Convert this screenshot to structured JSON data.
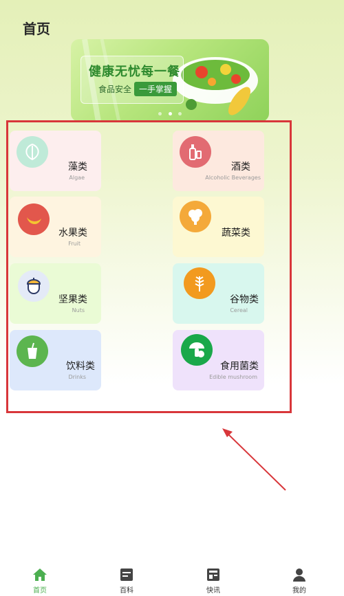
{
  "header": {
    "title": "首页"
  },
  "banner": {
    "headline": "健康无忧每一餐",
    "sub_text": "食品安全",
    "pill_text": "一手掌握",
    "slides": 3,
    "active_slide": 1
  },
  "categories": [
    {
      "name": "藻类",
      "en": "Algae",
      "bg": "#fdeeee",
      "icon_bg": "#bfead8"
    },
    {
      "name": "酒类",
      "en": "Alcoholic Beverages",
      "bg": "#fde9df",
      "icon_bg": "#e26b72"
    },
    {
      "name": "水果类",
      "en": "Fruit",
      "bg": "#fef4e0",
      "icon_bg": "#e2574c"
    },
    {
      "name": "蔬菜类",
      "en": "",
      "bg": "#fdf8d2",
      "icon_bg": "#f4a93a"
    },
    {
      "name": "坚果类",
      "en": "Nuts",
      "bg": "#eafbd5",
      "icon_bg": "#e4eaf7"
    },
    {
      "name": "谷物类",
      "en": "Cereal",
      "bg": "#d8f7ee",
      "icon_bg": "#f29a1f"
    },
    {
      "name": "饮料类",
      "en": "Drinks",
      "bg": "#dde8fb",
      "icon_bg": "#5cb54f"
    },
    {
      "name": "食用菌类",
      "en": "Edible mushroom",
      "bg": "#efe2fb",
      "icon_bg": "#1aa84a"
    }
  ],
  "tabbar": {
    "items": [
      {
        "label": "首页",
        "icon": "home-icon",
        "active": true
      },
      {
        "label": "百科",
        "icon": "book-icon",
        "active": false
      },
      {
        "label": "快讯",
        "icon": "news-icon",
        "active": false
      },
      {
        "label": "我的",
        "icon": "user-icon",
        "active": false
      }
    ],
    "active_color": "#4caf50"
  },
  "annotation": {
    "frame_color": "#d8363a"
  }
}
